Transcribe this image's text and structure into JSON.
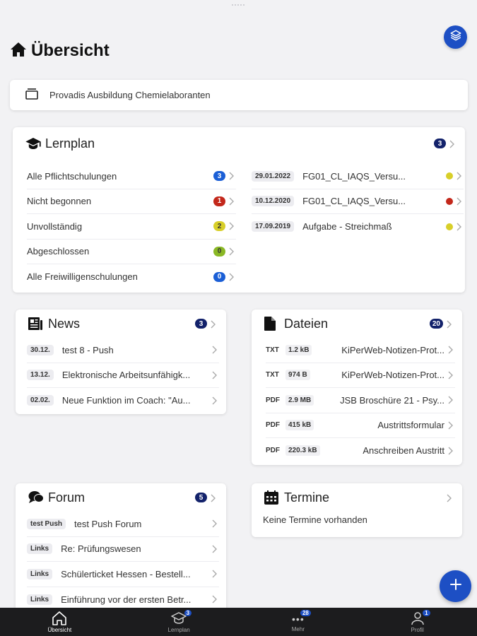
{
  "page": {
    "title": "Übersicht"
  },
  "org": {
    "name": "Provadis Ausbildung Chemielaboranten"
  },
  "lernplan": {
    "title": "Lernplan",
    "count": "3",
    "categories": [
      {
        "label": "Alle Pflichtschulungen",
        "count": "3",
        "color": "#1b5fd6"
      },
      {
        "label": "Nicht begonnen",
        "count": "1",
        "color": "#c3281b"
      },
      {
        "label": "Unvollständig",
        "count": "2",
        "color": "#d8cf29"
      },
      {
        "label": "Abgeschlossen",
        "count": "0",
        "color": "#8ab825"
      },
      {
        "label": "Alle Freiwilligenschulungen",
        "count": "0",
        "color": "#1b5fd6"
      }
    ],
    "recent": [
      {
        "date": "29.01.2022",
        "title": "FG01_CL_IAQS_Versu...",
        "status_color": "#d8cf29"
      },
      {
        "date": "10.12.2020",
        "title": "FG01_CL_IAQS_Versu...",
        "status_color": "#c3281b"
      },
      {
        "date": "17.09.2019",
        "title": "Aufgabe - Streichmaß",
        "status_color": "#d8cf29"
      }
    ]
  },
  "news": {
    "title": "News",
    "count": "3",
    "items": [
      {
        "date": "30.12.",
        "title": "test 8 - Push"
      },
      {
        "date": "13.12.",
        "title": "Elektronische Arbeitsunfähigk..."
      },
      {
        "date": "02.02.",
        "title": "Neue Funktion im Coach: \"Au..."
      }
    ]
  },
  "dateien": {
    "title": "Dateien",
    "count": "20",
    "items": [
      {
        "type": "TXT",
        "size": "1.2 kB",
        "name": "KiPerWeb-Notizen-Prot..."
      },
      {
        "type": "TXT",
        "size": "974 B",
        "name": "KiPerWeb-Notizen-Prot..."
      },
      {
        "type": "PDF",
        "size": "2.9 MB",
        "name": "JSB Broschüre 21 - Psy..."
      },
      {
        "type": "PDF",
        "size": "415 kB",
        "name": "Austrittsformular"
      },
      {
        "type": "PDF",
        "size": "220.3 kB",
        "name": "Anschreiben Austritt"
      }
    ]
  },
  "forum": {
    "title": "Forum",
    "count": "5",
    "items": [
      {
        "tag": "test Push",
        "title": "test Push Forum"
      },
      {
        "tag": "Links",
        "title": "Re: Prüfungswesen"
      },
      {
        "tag": "Links",
        "title": "Schülerticket Hessen - Bestell..."
      },
      {
        "tag": "Links",
        "title": "Einführung vor der ersten Betr..."
      }
    ]
  },
  "termine": {
    "title": "Termine",
    "empty_text": "Keine Termine vorhanden"
  },
  "tabbar": {
    "tabs": [
      {
        "label": "Übersicht",
        "badge": ""
      },
      {
        "label": "Lernplan",
        "badge": "3"
      },
      {
        "label": "Mehr",
        "badge": "28"
      },
      {
        "label": "Profil",
        "badge": "1"
      }
    ]
  }
}
